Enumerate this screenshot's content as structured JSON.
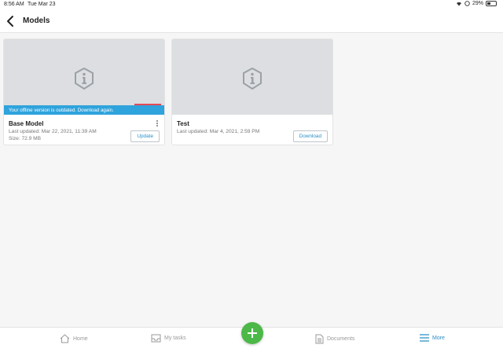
{
  "status_bar": {
    "time": "8:56 AM",
    "date": "Tue Mar 23",
    "battery": "29%"
  },
  "header": {
    "title": "Models"
  },
  "models": [
    {
      "name": "Base Model",
      "banner": "Your offline version is outdated. Download again.",
      "updated": "Last updated: Mar 22, 2021, 11:39 AM",
      "size": "Size: 72.9 MB",
      "action": "Update"
    },
    {
      "name": "Test",
      "updated": "Last updated: Mar 4, 2021, 2:59 PM",
      "action": "Download"
    }
  ],
  "tabbar": {
    "home": "Home",
    "tasks": "My tasks",
    "documents": "Documents",
    "more": "More"
  },
  "colors": {
    "accent": "#2b8fc7",
    "banner": "#2ea3dc",
    "fab": "#4cb848"
  }
}
